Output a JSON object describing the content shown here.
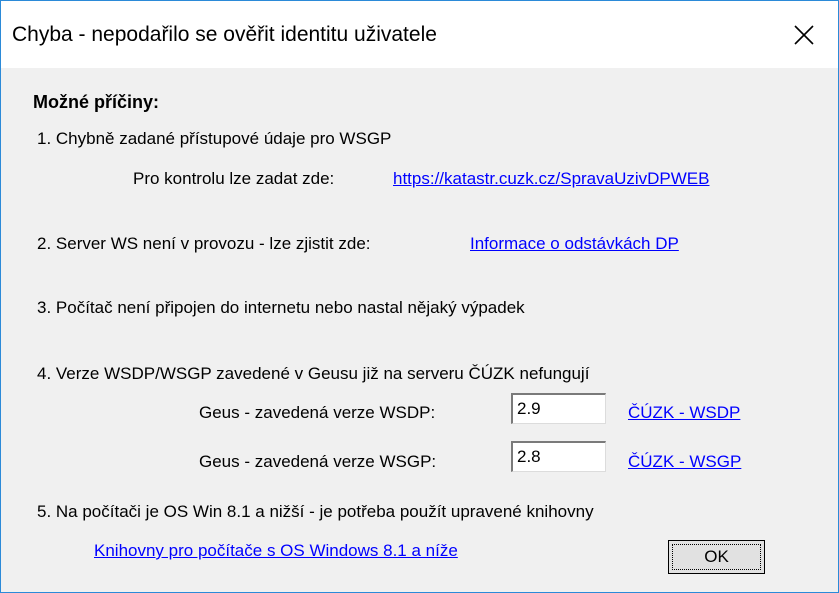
{
  "window": {
    "title": "Chyba - nepodařilo se ověřit identitu uživatele"
  },
  "content": {
    "heading": "Možné příčiny:",
    "reason1": "1. Chybně zadané přístupové údaje pro WSGP",
    "reason1_hint": "Pro kontrolu lze zadat zde:",
    "reason1_link": "https://katastr.cuzk.cz/SpravaUzivDPWEB",
    "reason2": "2. Server WS není v provozu - lze zjistit zde:",
    "reason2_link": "Informace o odstávkách DP",
    "reason3": "3. Počítač není připojen do internetu nebo nastal nějaký výpadek",
    "reason4": "4. Verze WSDP/WSGP zavedené v Geusu již na serveru ČÚZK nefungují",
    "wsdp_label": "Geus - zavedená verze WSDP:",
    "wsdp_value": "2.9",
    "wsdp_link": "ČÚZK - WSDP",
    "wsgp_label": "Geus - zavedená verze WSGP:",
    "wsgp_value": "2.8",
    "wsgp_link": "ČÚZK - WSGP",
    "reason5": "5. Na počítači je OS Win 8.1 a nižší - je potřeba použít upravené knihovny",
    "reason5_link": "Knihovny pro počítače s OS Windows 8.1 a níže",
    "ok_label": "OK"
  },
  "icons": {
    "close": "close-icon"
  },
  "colors": {
    "link": "#0000ff",
    "border": "#2b8ad8",
    "background": "#f0f0f0"
  }
}
